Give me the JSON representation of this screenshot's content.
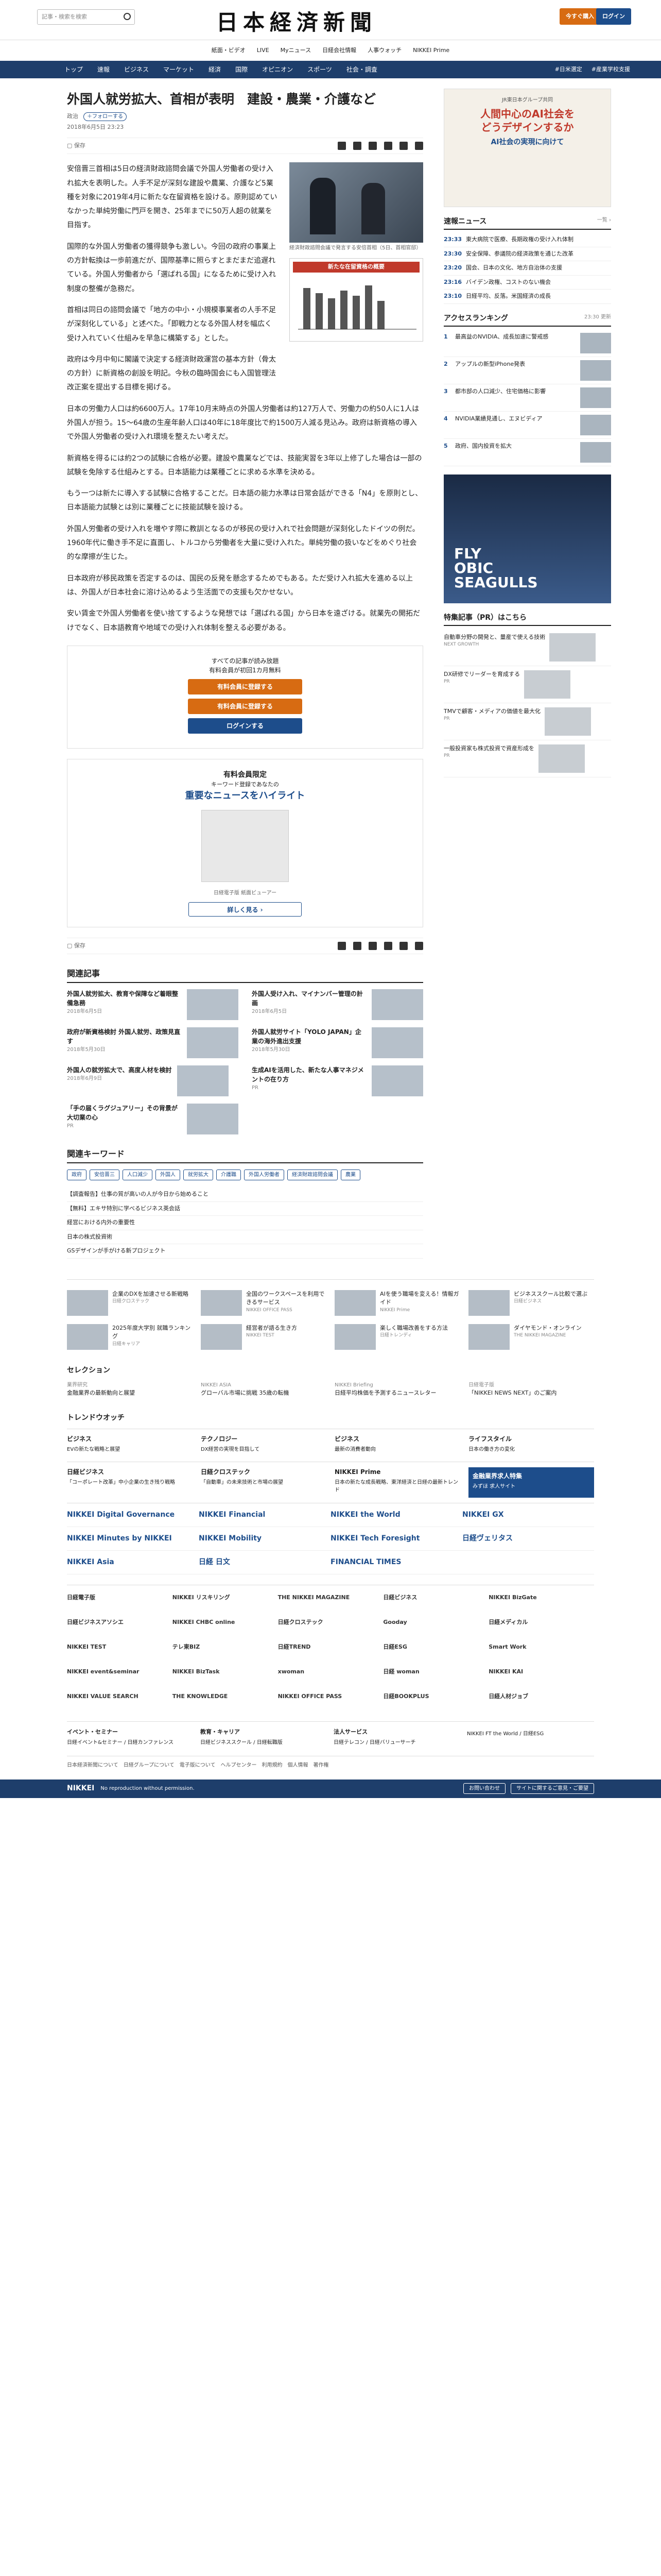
{
  "header": {
    "search_placeholder": "記事・検索を検索",
    "logo": "日本経済新聞",
    "subscribe": "今すぐ購入",
    "login": "ログイン",
    "util": [
      "紙面・ビデオ",
      "LIVE",
      "Myニュース",
      "日経会社情報",
      "人事ウォッチ",
      "NIKKEI Prime"
    ]
  },
  "nav": {
    "items": [
      "トップ",
      "速報",
      "ビジネス",
      "マーケット",
      "経済",
      "国際",
      "オピニオン",
      "スポーツ",
      "社会・調査"
    ],
    "right": [
      "#日米選定",
      "#産業学校支援"
    ]
  },
  "article": {
    "tag": "政治",
    "title": "外国人就労拡大、首相が表明　建設・農業・介護など",
    "section": "政治",
    "follow": "＋フォローする",
    "date": "2018年6月5日 23:23",
    "p1": "安倍晋三首相は5日の経済財政諮問会議で外国人労働者の受け入れ拡大を表明した。人手不足が深刻な建設や農業、介護など5業種を対象に2019年4月に新たな在留資格を設ける。原則認めていなかった単純労働に門戸を開き、25年までに50万人超の就業を目指す。",
    "p2": "国際的な外国人労働者の獲得競争も激しい。今回の政府の事業上の方針転換は一歩前進だが、国際基準に照らすとまだまだ追遅れている。外国人労働者から「選ばれる国」になるために受け入れ制度の整備が急務だ。",
    "p3": "首相は同日の諮問会議で「地方の中小・小規模事業者の人手不足が深刻化している」と述べた。「即戦力となる外国人材を幅広く受け入れていく仕組みを早急に構築する」とした。",
    "p4": "政府は今月中旬に閣議で決定する経済財政運営の基本方針（骨太の方針）に新資格の創設を明記。今秋の臨時国会にも入国管理法改正案を提出する目標を掲げる。",
    "p5": "日本の労働力人口は約6600万人。17年10月末時点の外国人労働者は約127万人で、労働力の約50人に1人は外国人が担う。15〜64歳の生産年齢人口は40年に18年度比で約1500万人減る見込み。政府は新資格の導入で外国人労働者の受け入れ環境を整えたい考えだ。",
    "p6": "新資格を得るには約2つの試験に合格が必要。建設や農業などでは、技能実習を3年以上修了した場合は一部の試験を免除する仕組みとする。日本語能力は業種ごとに求める水準を決める。",
    "p7": "もう一つは新たに導入する試験に合格することだ。日本語の能力水準は日常会話ができる「N4」を原則とし、日本語能力試験とは別に業種ごとに技能試験を設ける。",
    "p8": "外国人労働者の受け入れを増やす際に教訓となるのが移民の受け入れで社会問題が深刻化したドイツの例だ。1960年代に働き手不足に直面し、トルコから労働者を大量に受け入れた。単純労働の扱いなどをめぐり社会的な摩擦が生じた。",
    "p9": "日本政府が移民政策を否定するのは、国民の反発を懸念するためでもある。ただ受け入れ拡大を進める以上は、外国人が日本社会に溶け込めるよう生活面での支援も欠かせない。",
    "p10": "安い賃金で外国人労働者を使い捨てするような発想では「選ばれる国」から日本を遠ざける。就業先の開拓だけでなく、日本語教育や地域での受け入れ体制を整える必要がある。",
    "photo_cap": "経済財政諮問会議で発言する安倍首相（5日、首相官邸）",
    "chart_title": "新たな在留資格の概要",
    "pay_text": "すべての記事が読み放題\n有料会員が初回1カ月無料",
    "pay_btn1": "有料会員に登録する",
    "pay_btn2": "有料会員に登録する",
    "pay_login": "ログインする",
    "hl_small": "有料会員限定",
    "hl_sub": "キーワード登録であなたの",
    "hl_big": "重要なニュースをハイライト",
    "hl_cap": "日経電子版 紙面ビューアー",
    "hl_btn": "詳しく見る ›"
  },
  "related": {
    "title": "関連記事",
    "items": [
      {
        "t": "外国人就労拡大、教育や保障など着眼整備急務",
        "d": "2018年6月5日"
      },
      {
        "t": "外国人受け入れ、マイナンバー管理の計画",
        "d": "2018年6月5日"
      },
      {
        "t": "政府が新資格検討 外国人就労、政策見直す",
        "d": "2018年5月30日"
      },
      {
        "t": "外国人就労サイト「YOLO JAPAN」企業の海外進出支援",
        "d": "2018年5月30日"
      },
      {
        "t": "外国人の就労拡大で、高度人材を検討",
        "d": "2018年6月9日"
      },
      {
        "t": "生成AIを活用した、新たな人事マネジメントの在り方",
        "d": "PR"
      },
      {
        "t": "「手の届くラグジュアリー」その背景が大切業の心",
        "d": "PR"
      }
    ]
  },
  "keywords": {
    "title": "関連キーワード",
    "tags": [
      "政府",
      "安倍晋三",
      "人口減少",
      "外国人",
      "就労拡大",
      "介護職",
      "外国人労働者",
      "経済財政諮問会議",
      "農業"
    ]
  },
  "links": [
    "【調査報告】仕事の質が高いの人が今日から始めること",
    "【無料】エキサ特別に学べるビジネス英会話",
    "経営における内外の重要性",
    "日本の株式投資術",
    "GSデザインが手がける新プロジェクト"
  ],
  "side": {
    "ad_small": "JR東日本グループ共同",
    "ad_head": "人間中心のAI社会を\nどうデザインするか",
    "ad_sub": "AI社会の実現に向けて",
    "news_title": "速報ニュース",
    "news_more": "一覧 ›",
    "news": [
      {
        "t": "23:33",
        "s": "東大病院で医療、長期政権の受け入れ体制"
      },
      {
        "t": "23:30",
        "s": "安全保障、参議院の経済政策を通じた改革"
      },
      {
        "t": "23:20",
        "s": "国会、日本の文化、地方自治体の支援"
      },
      {
        "t": "23:16",
        "s": "バイデン政権、コストのない機会"
      },
      {
        "t": "23:10",
        "s": "日経平均、反落。米国経済の成長"
      }
    ],
    "rank_title": "アクセスランキング",
    "rank_time": "23:30 更新",
    "rank": [
      "最高益のNVIDIA、成長加速に警戒感",
      "アップルの新型iPhone発表",
      "都市部の人口減少、住宅価格に影響",
      "NVIDIA業績見通し、エヌビディア",
      "政府、国内投資を拡大"
    ],
    "ad2": "FLY\nOBIC\nSEAGULLS",
    "pr_title": "特集記事（PR）はこちら",
    "pr": [
      {
        "t": "自動車分野の開発と、量産で使える技術",
        "s": "NEXT GROWTH"
      },
      {
        "t": "DX研修でリーダーを育成する",
        "s": "PR"
      },
      {
        "t": "TMVで顧客・メディアの価値を最大化",
        "s": "PR"
      },
      {
        "t": "一般投資家も株式投資で資産形成を",
        "s": "PR"
      }
    ]
  },
  "footer": {
    "cards": [
      {
        "t": "企業のDXを加速させる新戦略",
        "s": "日経クロステック"
      },
      {
        "t": "全国のワークスペースを利用できるサービス",
        "s": "NIKKEI OFFICE PASS"
      },
      {
        "t": "AIを使う職場を変える！情報ガイド",
        "s": "NIKKEI Prime"
      },
      {
        "t": "ビジネススクール比較で選ぶ",
        "s": "日経ビジネス"
      },
      {
        "t": "2025年度大学別 就職ランキング",
        "s": "日経キャリア"
      },
      {
        "t": "経営者が語る生き方",
        "s": "NIKKEI TEST"
      },
      {
        "t": "楽しく職場改善をする方法",
        "s": "日経トレンディ"
      },
      {
        "t": "ダイヤモンド・オンライン",
        "s": "THE NIKKEI MAGAZINE"
      }
    ],
    "sel_title": "セレクション",
    "sel": [
      {
        "t": "金融業界の最新動向と展望",
        "s": "業界研究"
      },
      {
        "t": "グローバル市場に挑戦 35歳の転機",
        "s": "NIKKEI ASIA"
      },
      {
        "t": "日経平均株価を予測するニュースレター",
        "s": "NIKKEI Briefing"
      },
      {
        "t": "「NIKKEI NEWS NEXT」のご案内",
        "s": "日経電子版"
      }
    ],
    "trend_title": "トレンドウオッチ",
    "trend": [
      {
        "h": "ビジネス",
        "b": "EVの新たな戦略と展望"
      },
      {
        "h": "テクノロジー",
        "b": "DX経営の実現を目指して"
      },
      {
        "h": "ビジネス",
        "b": "最新の消費者動向"
      },
      {
        "h": "ライフスタイル",
        "b": "日本の働き方の変化"
      }
    ],
    "svc": [
      {
        "h": "日経ビジネス",
        "p": "「コーポレート改革」中小企業の生き残り戦略"
      },
      {
        "h": "日経クロステック",
        "p": "「自動車」の未来技術と市場の展望"
      },
      {
        "h": "NIKKEI Prime",
        "p": "日本の新たな成長戦略、東洋経済と日経の最新トレンド"
      },
      {
        "h": "金融業界求人特集",
        "p": "みずほ 求人サイト"
      }
    ],
    "brands1": [
      "NIKKEI Digital Governance",
      "NIKKEI Financial",
      "NIKKEI the World",
      "NIKKEI GX",
      "NIKKEI Minutes by NIKKEI",
      "NIKKEI Mobility",
      "NIKKEI Tech Foresight",
      "日経ヴェリタス",
      "NIKKEI Asia",
      "日経 日文",
      "FINANCIAL TIMES",
      ""
    ],
    "brands2": [
      "日経電子版",
      "NIKKEI リスキリング",
      "THE NIKKEI MAGAZINE",
      "日経ビジネス",
      "NIKKEI BizGate",
      "日経ビジネスアソシエ",
      "NIKKEI CHBC online",
      "日経クロステック",
      "Gooday",
      "日経メディカル",
      "NIKKEI TEST",
      "テレ東BIZ",
      "日経TREND",
      "日経ESG",
      "Smart Work",
      "NIKKEI event&seminar",
      "NIKKEI BizTask",
      "xwoman",
      "日経 woman",
      "NIKKEI KAI",
      "NIKKEI VALUE SEARCH",
      "THE KNOWLEDGE",
      "NIKKEI OFFICE PASS",
      "日経BOOKPLUS",
      "日経人材ジョブ"
    ],
    "foot_cols": [
      {
        "h": "イベント・セミナー",
        "i": "日経イベント&セミナー / 日経カンファレンス"
      },
      {
        "h": "教育・キャリア",
        "i": "日経ビジネススクール / 日経転職版"
      },
      {
        "h": "法人サービス",
        "i": "日経テレコン / 日経バリューサーチ"
      },
      {
        "h": "",
        "i": "NIKKEI FT the World / 日経ESG"
      }
    ],
    "bottom": "日本経済新聞について　日経グループについて　電子版について　ヘルプセンター　利用規約　個人情報　著作権",
    "bar_logo": "NIKKEI",
    "bar_text": "No reproduction without permission.",
    "bar_btn1": "お問い合わせ",
    "bar_btn2": "サイトに関するご意見・ご要望"
  }
}
